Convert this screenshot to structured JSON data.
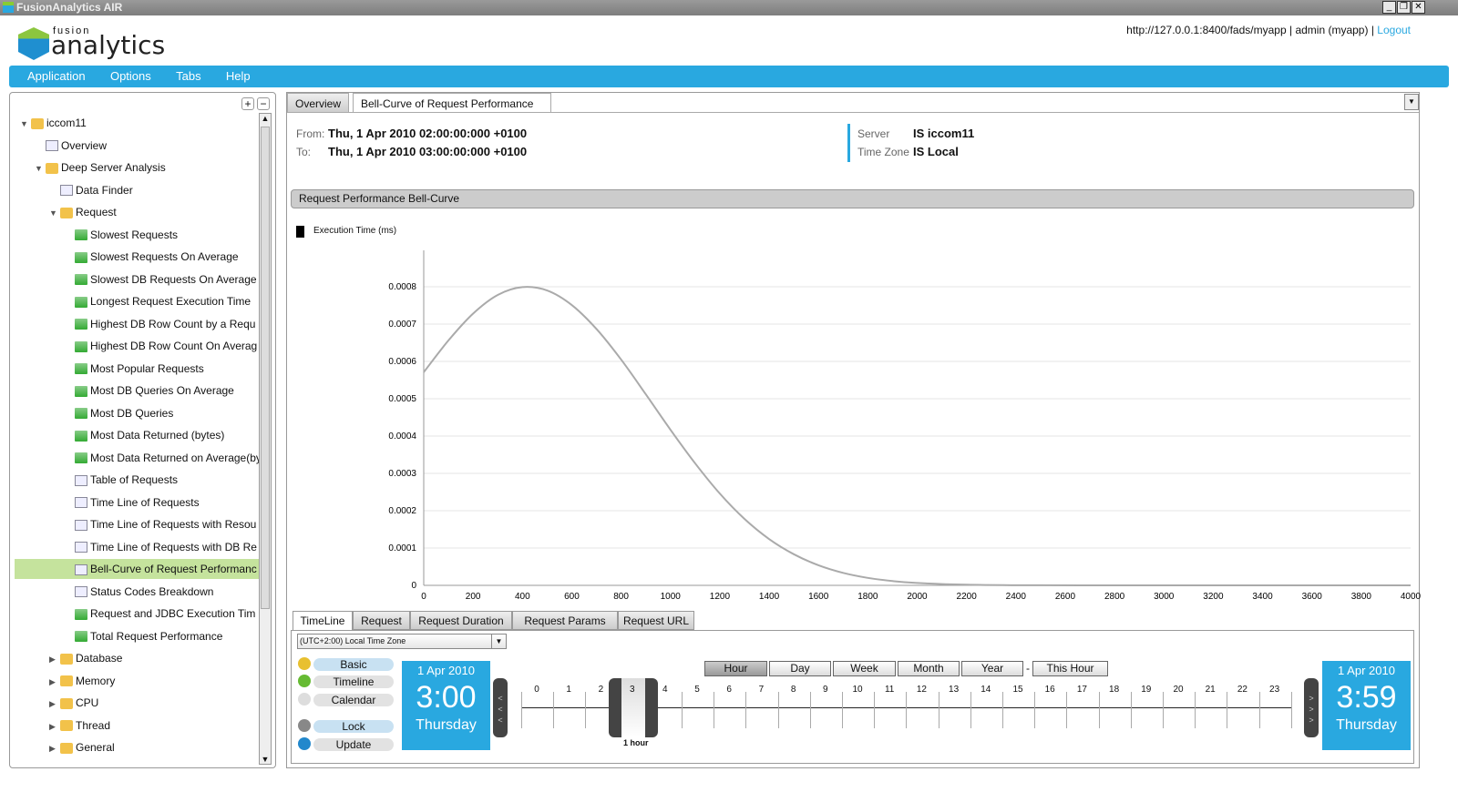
{
  "window": {
    "title": "FusionAnalytics AIR",
    "controls": [
      "_",
      "❐",
      "✕"
    ]
  },
  "header": {
    "logo_small": "fusion",
    "logo_big": "analytics",
    "url": "http://127.0.0.1:8400/fads/myapp",
    "user": "admin (myapp)",
    "logout": "Logout",
    "sep": "|"
  },
  "menu": [
    "Application",
    "Options",
    "Tabs",
    "Help"
  ],
  "sidebar": {
    "expand": "+",
    "collapse": "−",
    "items": [
      {
        "label": "iccom11",
        "level": 0,
        "icon": "folder-icon",
        "expanded": true
      },
      {
        "label": "Overview",
        "level": 1,
        "icon": "overview-icon"
      },
      {
        "label": "Deep Server Analysis",
        "level": 1,
        "icon": "folder-icon",
        "expanded": true
      },
      {
        "label": "Data Finder",
        "level": 2,
        "icon": "binoculars-icon"
      },
      {
        "label": "Request",
        "level": 2,
        "icon": "folder-icon",
        "expanded": true
      },
      {
        "label": "Slowest Requests",
        "level": 3,
        "icon": "report-icon"
      },
      {
        "label": "Slowest Requests On Average",
        "level": 3,
        "icon": "report-icon"
      },
      {
        "label": "Slowest DB Requests On Average",
        "level": 3,
        "icon": "report-icon"
      },
      {
        "label": "Longest Request Execution Time",
        "level": 3,
        "icon": "report-icon"
      },
      {
        "label": "Highest DB Row Count by a Requ",
        "level": 3,
        "icon": "report-icon"
      },
      {
        "label": "Highest DB Row Count On Averag",
        "level": 3,
        "icon": "report-icon"
      },
      {
        "label": "Most Popular Requests",
        "level": 3,
        "icon": "report-icon"
      },
      {
        "label": "Most DB Queries On Average",
        "level": 3,
        "icon": "report-icon"
      },
      {
        "label": "Most DB Queries",
        "level": 3,
        "icon": "report-icon"
      },
      {
        "label": "Most Data Returned (bytes)",
        "level": 3,
        "icon": "report-icon"
      },
      {
        "label": "Most Data Returned on Average(by",
        "level": 3,
        "icon": "report-icon"
      },
      {
        "label": "Table of Requests",
        "level": 3,
        "icon": "table-icon"
      },
      {
        "label": "Time Line of Requests",
        "level": 3,
        "icon": "timeline-icon"
      },
      {
        "label": "Time Line of Requests with Resou",
        "level": 3,
        "icon": "timeline-icon"
      },
      {
        "label": "Time Line of Requests with DB Re",
        "level": 3,
        "icon": "timeline-icon"
      },
      {
        "label": "Bell-Curve of Request Performanc",
        "level": 3,
        "icon": "bellcurve-icon",
        "selected": true
      },
      {
        "label": "Status Codes Breakdown",
        "level": 3,
        "icon": "bellcurve-icon"
      },
      {
        "label": "Request and JDBC Execution Tim",
        "level": 3,
        "icon": "report-icon"
      },
      {
        "label": "Total Request Performance",
        "level": 3,
        "icon": "report-icon"
      },
      {
        "label": "Database",
        "level": 2,
        "icon": "folder-icon",
        "expanded": false
      },
      {
        "label": "Memory",
        "level": 2,
        "icon": "folder-icon",
        "expanded": false
      },
      {
        "label": "CPU",
        "level": 2,
        "icon": "folder-icon",
        "expanded": false
      },
      {
        "label": "Thread",
        "level": 2,
        "icon": "folder-icon",
        "expanded": false
      },
      {
        "label": "General",
        "level": 2,
        "icon": "folder-icon",
        "expanded": false
      }
    ]
  },
  "tabs": [
    {
      "label": "Overview"
    },
    {
      "label": "Bell-Curve of Request Performance",
      "active": true
    }
  ],
  "info": {
    "from_label": "From:",
    "from": "Thu, 1 Apr 2010 02:00:00:000 +0100",
    "to_label": "To:",
    "to": "Thu, 1 Apr 2010 03:00:00:000 +0100",
    "server_label": "Server",
    "server": "IS iccom11",
    "tz_label": "Time Zone",
    "tz": "IS Local"
  },
  "panel_title": "Request Performance Bell-Curve",
  "chart_data": {
    "type": "line",
    "legend": "top-left",
    "series": [
      {
        "name": "Execution Time (ms)",
        "color": "#aaaaaa",
        "x": [
          0,
          100,
          200,
          300,
          400,
          500,
          600,
          700,
          800,
          900,
          1000,
          1100,
          1200,
          1300,
          1400,
          1500,
          1600,
          1700,
          1800,
          1900,
          2000,
          2200,
          2400,
          2800,
          3200,
          3600,
          4000
        ],
        "y": [
          0.000571,
          0.000656,
          0.000728,
          0.000778,
          0.000799,
          0.00079,
          0.000751,
          0.000687,
          0.000605,
          0.000512,
          0.000417,
          0.000327,
          0.000246,
          0.000178,
          0.000124,
          8.34e-05,
          5.38e-05,
          3.34e-05,
          2e-05,
          1.15e-05,
          6.3e-06,
          1.7e-06,
          4e-07,
          0,
          0,
          0,
          0
        ]
      }
    ],
    "xlim": [
      0,
      4000
    ],
    "ylim": [
      0,
      0.0009
    ],
    "xticks": [
      "0",
      "200",
      "400",
      "600",
      "800",
      "1000",
      "1200",
      "1400",
      "1600",
      "1800",
      "2000",
      "2200",
      "2400",
      "2600",
      "2800",
      "3000",
      "3200",
      "3400",
      "3600",
      "3800",
      "4000"
    ],
    "yticks": [
      "0",
      "0.0001",
      "0.0002",
      "0.0003",
      "0.0004",
      "0.0005",
      "0.0006",
      "0.0007",
      "0.0008"
    ],
    "grid": true
  },
  "bottom_tabs": [
    {
      "label": "TimeLine",
      "active": true
    },
    {
      "label": "Request"
    },
    {
      "label": "Request Duration"
    },
    {
      "label": "Request Params"
    },
    {
      "label": "Request URL"
    }
  ],
  "timezone_select": "(UTC+2:00) Local Time Zone",
  "side_buttons": [
    "Basic",
    "Timeline",
    "Calendar",
    "Lock",
    "Update"
  ],
  "range_buttons": [
    "Hour",
    "Day",
    "Week",
    "Month",
    "Year",
    "This Hour"
  ],
  "range_sep": "-",
  "start": {
    "date": "1 Apr 2010",
    "time": "3:00",
    "day": "Thursday"
  },
  "end": {
    "date": "1 Apr 2010",
    "time": "3:59",
    "day": "Thursday"
  },
  "hours": [
    "0",
    "1",
    "2",
    "3",
    "4",
    "5",
    "6",
    "7",
    "8",
    "9",
    "10",
    "11",
    "12",
    "13",
    "14",
    "15",
    "16",
    "17",
    "18",
    "19",
    "20",
    "21",
    "22",
    "23"
  ],
  "selection_label": "1 hour",
  "accent": "#29a8e0"
}
